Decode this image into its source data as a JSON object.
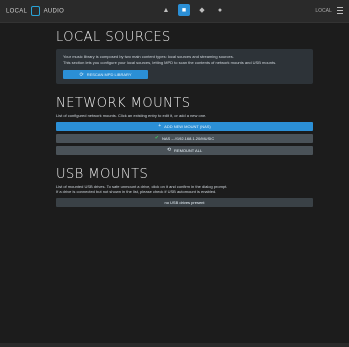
{
  "topbar": {
    "brand_left": "LOCAL",
    "brand_right": "AUDIO",
    "nav": [
      "▲",
      "■",
      "◆",
      "●"
    ],
    "user": "LOCAL"
  },
  "local_sources": {
    "title": "LOCAL SOURCES",
    "desc_line1": "Your music library is composed by two main content types: local sources and streaming sources.",
    "desc_line2": "This section lets you configure your local sources, letting MPD to scan the contents of network mounts and USB mounts.",
    "button": "RESCAN MPD LIBRARY"
  },
  "network_mounts": {
    "title": "NETWORK MOUNTS",
    "desc": "List of configured network mounts. Click an existing entry to edit it, or add a new one.",
    "add_button": "ADD NEW MOUNT (NAS)",
    "entry_label": "NAS",
    "entry_detail": "//192.168.1.20/MUSIC",
    "remount_button": "REMOUNT ALL"
  },
  "usb_mounts": {
    "title": "USB MOUNTS",
    "desc_line1": "List of mounted USB drives. To safe unmount a drive, click on it and confirm in the dialog prompt.",
    "desc_line2": "If a drive is connected but not shown in the list, please check if USB automount is enabled.",
    "empty": "no USB drives present"
  }
}
